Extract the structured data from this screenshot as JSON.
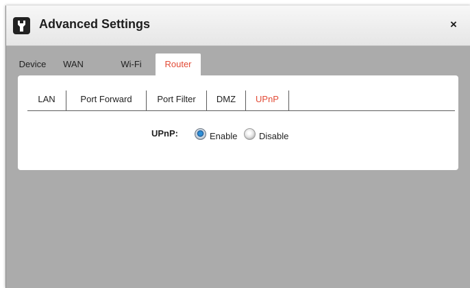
{
  "dialog": {
    "title": "Advanced Settings",
    "title_icon": "wrench-icon",
    "close_label": "×"
  },
  "tabs": [
    {
      "label": "Device",
      "active": false
    },
    {
      "label": "WAN",
      "active": false
    },
    {
      "label": "Wi-Fi",
      "active": false
    },
    {
      "label": "Router",
      "active": true
    }
  ],
  "subtabs": [
    {
      "label": "LAN",
      "active": false
    },
    {
      "label": "Port Forward",
      "active": false
    },
    {
      "label": "Port Filter",
      "active": false
    },
    {
      "label": "DMZ",
      "active": false
    },
    {
      "label": "UPnP",
      "active": true
    }
  ],
  "upnp": {
    "label": "UPnP:",
    "options": [
      {
        "label": "Enable",
        "selected": true
      },
      {
        "label": "Disable",
        "selected": false
      }
    ]
  },
  "colors": {
    "accent": "#e24a35",
    "dialog_bg": "#ababab",
    "panel_bg": "#ffffff",
    "radio_selected": "#10508f"
  }
}
